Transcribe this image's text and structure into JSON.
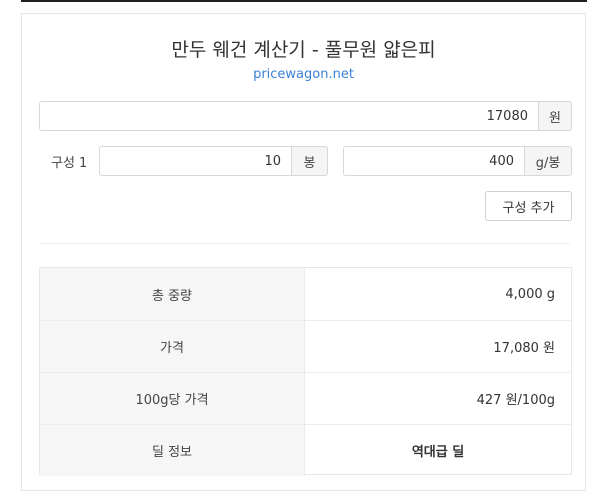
{
  "header": {
    "title": "만두 웨건 계산기 - 풀무원 얇은피",
    "site": "pricewagon.net"
  },
  "price": {
    "value": "17080",
    "unit": "원"
  },
  "components": [
    {
      "label": "구성 1",
      "count": {
        "value": "10",
        "unit": "봉"
      },
      "weight": {
        "value": "400",
        "unit": "g/봉"
      }
    }
  ],
  "add_button_label": "구성 추가",
  "results": [
    {
      "label": "총 중량",
      "value": "4,000 g"
    },
    {
      "label": "가격",
      "value": "17,080 원"
    },
    {
      "label": "100g당 가격",
      "value": "427 원/100g"
    },
    {
      "label": "딜 정보",
      "value": "역대급 딜"
    }
  ]
}
